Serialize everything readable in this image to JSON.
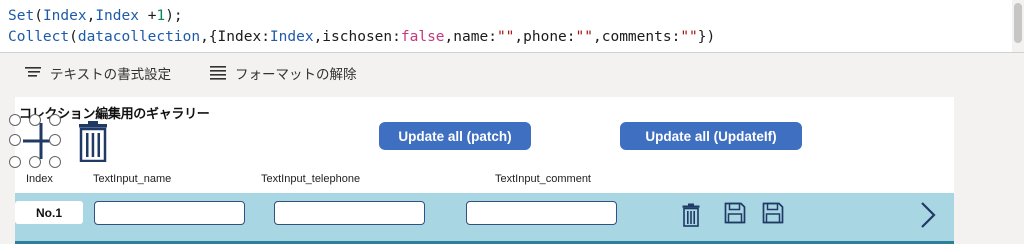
{
  "formula_bar": {
    "line1": {
      "fn": "Set",
      "open": "(",
      "arg1": "Index",
      "sep": ",",
      "arg2": "Index",
      "op": " +",
      "num": "1",
      "close": ");"
    },
    "line2": {
      "fn": "Collect",
      "open": "(",
      "coll": "datacollection",
      "rec_open": ",{",
      "k1": "Index",
      "c1": ":",
      "v1": "Index",
      "k2": ",ischosen",
      "c2": ":",
      "v2": "false",
      "k3": ",name",
      "c3": ":",
      "v3": "\"\"",
      "k4": ",phone",
      "c4": ":",
      "v4": "\"\"",
      "k5": ",comments",
      "c5": ":",
      "v5": "\"\"",
      "close": "})"
    }
  },
  "toolbar": {
    "format_text_label": "テキストの書式設定",
    "remove_format_label": "フォーマットの解除"
  },
  "gallery": {
    "title": "コレクション編集用のギャラリー",
    "update_patch_label": "Update all (patch)",
    "update_if_label": "Update all (UpdateIf)",
    "columns": {
      "index": "Index",
      "name": "TextInput_name",
      "telephone": "TextInput_telephone",
      "comment": "TextInput_comment"
    },
    "rows": [
      {
        "index": "No.1",
        "name": "",
        "telephone": "",
        "comment": ""
      }
    ]
  },
  "colors": {
    "button_blue": "#3f6fc0",
    "row_bg": "#a9d6e3",
    "icon_navy": "#203a66"
  }
}
